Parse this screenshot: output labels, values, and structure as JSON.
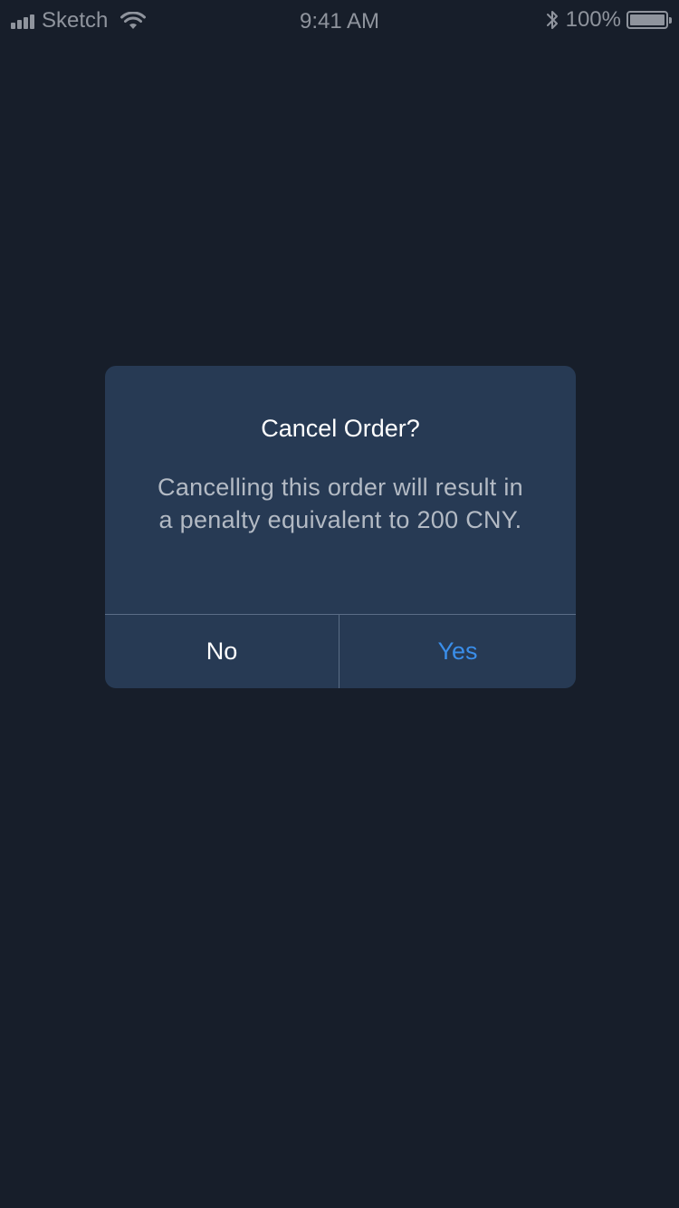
{
  "status_bar": {
    "carrier": "Sketch",
    "time": "9:41 AM",
    "battery_percent_label": "100%",
    "battery_level": 1.0,
    "icons": [
      "signal-icon",
      "wifi-icon",
      "bluetooth-icon",
      "battery-icon"
    ]
  },
  "dialog": {
    "title": "Cancel Order?",
    "message": "Cancelling this order will result in a penalty equivalent to 200 CNY.",
    "no_label": "No",
    "yes_label": "Yes"
  },
  "colors": {
    "background": "#171e2a",
    "dialog_background": "#273a54",
    "accent": "#3a8eea",
    "status_text": "#8f949d"
  }
}
